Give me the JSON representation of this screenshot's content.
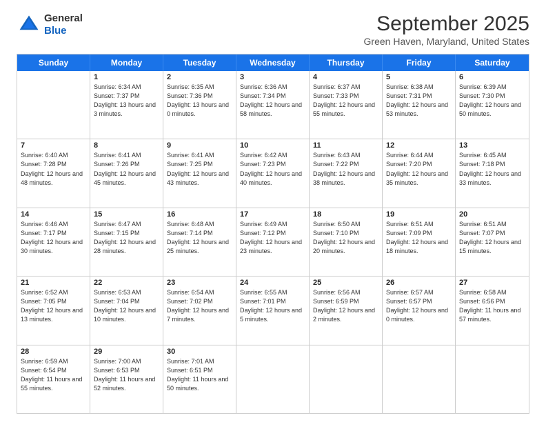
{
  "logo": {
    "general": "General",
    "blue": "Blue"
  },
  "title": "September 2025",
  "subtitle": "Green Haven, Maryland, United States",
  "days": [
    "Sunday",
    "Monday",
    "Tuesday",
    "Wednesday",
    "Thursday",
    "Friday",
    "Saturday"
  ],
  "weeks": [
    [
      {
        "day": "",
        "sunrise": "",
        "sunset": "",
        "daylight": ""
      },
      {
        "day": "1",
        "sunrise": "Sunrise: 6:34 AM",
        "sunset": "Sunset: 7:37 PM",
        "daylight": "Daylight: 13 hours and 3 minutes."
      },
      {
        "day": "2",
        "sunrise": "Sunrise: 6:35 AM",
        "sunset": "Sunset: 7:36 PM",
        "daylight": "Daylight: 13 hours and 0 minutes."
      },
      {
        "day": "3",
        "sunrise": "Sunrise: 6:36 AM",
        "sunset": "Sunset: 7:34 PM",
        "daylight": "Daylight: 12 hours and 58 minutes."
      },
      {
        "day": "4",
        "sunrise": "Sunrise: 6:37 AM",
        "sunset": "Sunset: 7:33 PM",
        "daylight": "Daylight: 12 hours and 55 minutes."
      },
      {
        "day": "5",
        "sunrise": "Sunrise: 6:38 AM",
        "sunset": "Sunset: 7:31 PM",
        "daylight": "Daylight: 12 hours and 53 minutes."
      },
      {
        "day": "6",
        "sunrise": "Sunrise: 6:39 AM",
        "sunset": "Sunset: 7:30 PM",
        "daylight": "Daylight: 12 hours and 50 minutes."
      }
    ],
    [
      {
        "day": "7",
        "sunrise": "Sunrise: 6:40 AM",
        "sunset": "Sunset: 7:28 PM",
        "daylight": "Daylight: 12 hours and 48 minutes."
      },
      {
        "day": "8",
        "sunrise": "Sunrise: 6:41 AM",
        "sunset": "Sunset: 7:26 PM",
        "daylight": "Daylight: 12 hours and 45 minutes."
      },
      {
        "day": "9",
        "sunrise": "Sunrise: 6:41 AM",
        "sunset": "Sunset: 7:25 PM",
        "daylight": "Daylight: 12 hours and 43 minutes."
      },
      {
        "day": "10",
        "sunrise": "Sunrise: 6:42 AM",
        "sunset": "Sunset: 7:23 PM",
        "daylight": "Daylight: 12 hours and 40 minutes."
      },
      {
        "day": "11",
        "sunrise": "Sunrise: 6:43 AM",
        "sunset": "Sunset: 7:22 PM",
        "daylight": "Daylight: 12 hours and 38 minutes."
      },
      {
        "day": "12",
        "sunrise": "Sunrise: 6:44 AM",
        "sunset": "Sunset: 7:20 PM",
        "daylight": "Daylight: 12 hours and 35 minutes."
      },
      {
        "day": "13",
        "sunrise": "Sunrise: 6:45 AM",
        "sunset": "Sunset: 7:18 PM",
        "daylight": "Daylight: 12 hours and 33 minutes."
      }
    ],
    [
      {
        "day": "14",
        "sunrise": "Sunrise: 6:46 AM",
        "sunset": "Sunset: 7:17 PM",
        "daylight": "Daylight: 12 hours and 30 minutes."
      },
      {
        "day": "15",
        "sunrise": "Sunrise: 6:47 AM",
        "sunset": "Sunset: 7:15 PM",
        "daylight": "Daylight: 12 hours and 28 minutes."
      },
      {
        "day": "16",
        "sunrise": "Sunrise: 6:48 AM",
        "sunset": "Sunset: 7:14 PM",
        "daylight": "Daylight: 12 hours and 25 minutes."
      },
      {
        "day": "17",
        "sunrise": "Sunrise: 6:49 AM",
        "sunset": "Sunset: 7:12 PM",
        "daylight": "Daylight: 12 hours and 23 minutes."
      },
      {
        "day": "18",
        "sunrise": "Sunrise: 6:50 AM",
        "sunset": "Sunset: 7:10 PM",
        "daylight": "Daylight: 12 hours and 20 minutes."
      },
      {
        "day": "19",
        "sunrise": "Sunrise: 6:51 AM",
        "sunset": "Sunset: 7:09 PM",
        "daylight": "Daylight: 12 hours and 18 minutes."
      },
      {
        "day": "20",
        "sunrise": "Sunrise: 6:51 AM",
        "sunset": "Sunset: 7:07 PM",
        "daylight": "Daylight: 12 hours and 15 minutes."
      }
    ],
    [
      {
        "day": "21",
        "sunrise": "Sunrise: 6:52 AM",
        "sunset": "Sunset: 7:05 PM",
        "daylight": "Daylight: 12 hours and 13 minutes."
      },
      {
        "day": "22",
        "sunrise": "Sunrise: 6:53 AM",
        "sunset": "Sunset: 7:04 PM",
        "daylight": "Daylight: 12 hours and 10 minutes."
      },
      {
        "day": "23",
        "sunrise": "Sunrise: 6:54 AM",
        "sunset": "Sunset: 7:02 PM",
        "daylight": "Daylight: 12 hours and 7 minutes."
      },
      {
        "day": "24",
        "sunrise": "Sunrise: 6:55 AM",
        "sunset": "Sunset: 7:01 PM",
        "daylight": "Daylight: 12 hours and 5 minutes."
      },
      {
        "day": "25",
        "sunrise": "Sunrise: 6:56 AM",
        "sunset": "Sunset: 6:59 PM",
        "daylight": "Daylight: 12 hours and 2 minutes."
      },
      {
        "day": "26",
        "sunrise": "Sunrise: 6:57 AM",
        "sunset": "Sunset: 6:57 PM",
        "daylight": "Daylight: 12 hours and 0 minutes."
      },
      {
        "day": "27",
        "sunrise": "Sunrise: 6:58 AM",
        "sunset": "Sunset: 6:56 PM",
        "daylight": "Daylight: 11 hours and 57 minutes."
      }
    ],
    [
      {
        "day": "28",
        "sunrise": "Sunrise: 6:59 AM",
        "sunset": "Sunset: 6:54 PM",
        "daylight": "Daylight: 11 hours and 55 minutes."
      },
      {
        "day": "29",
        "sunrise": "Sunrise: 7:00 AM",
        "sunset": "Sunset: 6:53 PM",
        "daylight": "Daylight: 11 hours and 52 minutes."
      },
      {
        "day": "30",
        "sunrise": "Sunrise: 7:01 AM",
        "sunset": "Sunset: 6:51 PM",
        "daylight": "Daylight: 11 hours and 50 minutes."
      },
      {
        "day": "",
        "sunrise": "",
        "sunset": "",
        "daylight": ""
      },
      {
        "day": "",
        "sunrise": "",
        "sunset": "",
        "daylight": ""
      },
      {
        "day": "",
        "sunrise": "",
        "sunset": "",
        "daylight": ""
      },
      {
        "day": "",
        "sunrise": "",
        "sunset": "",
        "daylight": ""
      }
    ]
  ]
}
